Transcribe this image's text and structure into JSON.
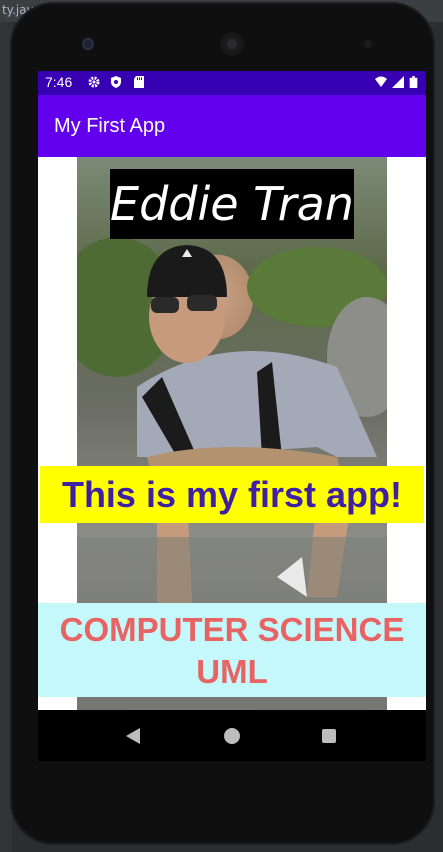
{
  "ide": {
    "tab_text": "ty.java"
  },
  "statusbar": {
    "time": "7:46",
    "icons": [
      "gear-icon",
      "shield-icon",
      "sd-card-icon",
      "wifi-icon",
      "signal-icon",
      "battery-icon"
    ]
  },
  "appbar": {
    "title": "My First App"
  },
  "content": {
    "name": "Eddie Tran",
    "tagline": "This is my first app!",
    "subject_line1": "COMPUTER SCIENCE",
    "subject_line2": "UML"
  },
  "navbar": {
    "icons": [
      "back-icon",
      "home-icon",
      "recents-icon"
    ]
  },
  "colors": {
    "status_bar": "#3700b3",
    "app_bar": "#6200ee",
    "tagline_bg": "#ffff00",
    "tagline_text": "#3f1fa3",
    "subject_bg": "#c5f8fa",
    "subject_text": "#e86363"
  }
}
